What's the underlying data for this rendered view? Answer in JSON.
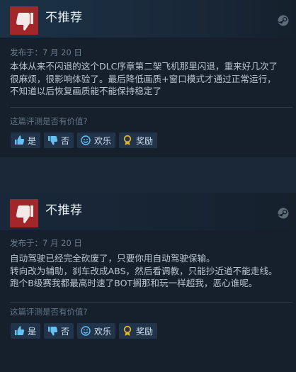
{
  "reviews": [
    {
      "verdict": "不推荐",
      "posted": "发布于：7 月 20 日",
      "body": "本体从来不闪退的这个DLC序章第二架飞机那里闪退，重来好几次了\n很麻烦，很影响体验了。最后降低画质+窗口模式才通过正常运行，\n不知道以后恢复画质能不能保持稳定了",
      "helpful_prompt": "这篇评测是否有价值?",
      "buttons": {
        "yes": "是",
        "no": "否",
        "funny": "欢乐",
        "award": "奖励"
      }
    },
    {
      "verdict": "不推荐",
      "posted": "发布于：7 月 20 日",
      "body": "自动驾驶已经完全砍废了，只要你用自动驾驶保输。\n转向改为辅助，刹车改成ABS，然后看调教，只能抄近道不能走线。\n跑个B级赛我都最高时速了BOT搁那和玩一样超我，恶心谁呢。",
      "helpful_prompt": "这篇评测是否有价值?",
      "buttons": {
        "yes": "是",
        "no": "否",
        "funny": "欢乐",
        "award": "奖励"
      }
    }
  ],
  "icons": {
    "verdict": "thumbs-down-icon",
    "platform": "steam-icon",
    "yes": "thumbs-up-icon",
    "no": "thumbs-down-icon",
    "funny": "smiley-icon",
    "award": "award-ribbon-icon"
  },
  "colors": {
    "background": "#1b2838",
    "review_bg": "#16202d",
    "not_recommended": "#a3262b",
    "button_bg": "#223449",
    "award_icon": "#e1b12c"
  }
}
